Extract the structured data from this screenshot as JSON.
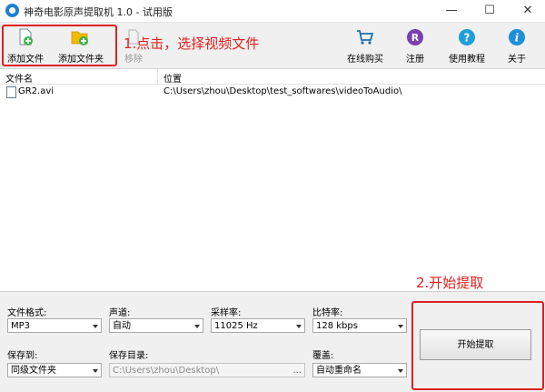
{
  "window": {
    "title": "神奇电影原声提取机 1.0 - 试用版",
    "minimize": "—",
    "maximize": "☐",
    "close": "✕"
  },
  "toolbar": {
    "add_file": "添加文件",
    "add_folder": "添加文件夹",
    "remove": "移除",
    "buy_online": "在线购买",
    "register": "注册",
    "tutorial": "使用教程",
    "about": "关于",
    "register_letter": "R",
    "tutorial_mark": "?",
    "about_mark": "i"
  },
  "annotations": {
    "step1": "1.点击，选择视频文件",
    "step2": "2.开始提取"
  },
  "file_list": {
    "columns": [
      "文件名",
      "位置"
    ],
    "rows": [
      {
        "name": "GR2.avi",
        "location": "C:\\Users\\zhou\\Desktop\\test_softwares\\videoToAudio\\"
      }
    ]
  },
  "settings": {
    "format_label": "文件格式:",
    "format_value": "MP3",
    "channel_label": "声道:",
    "channel_value": "自动",
    "samplerate_label": "采样率:",
    "samplerate_value": "11025 Hz",
    "bitrate_label": "比特率:",
    "bitrate_value": "128 kbps",
    "saveto_label": "保存到:",
    "saveto_value": "同级文件夹",
    "savedir_label": "保存目录:",
    "savedir_value": "C:\\Users\\zhou\\Desktop\\",
    "savedir_browse": "...",
    "overwrite_label": "覆盖:",
    "overwrite_value": "自动重命名"
  },
  "start_button": "开始提取",
  "colors": {
    "annotation": "#e02020",
    "app_icon": "#1e7fd2",
    "buy_cart": "#1a6fb3",
    "register": "#7a3fb0",
    "tutorial": "#1e9fd8",
    "about": "#1e8fd8",
    "add_green": "#3bb24a",
    "folder_yellow": "#f5b800"
  }
}
